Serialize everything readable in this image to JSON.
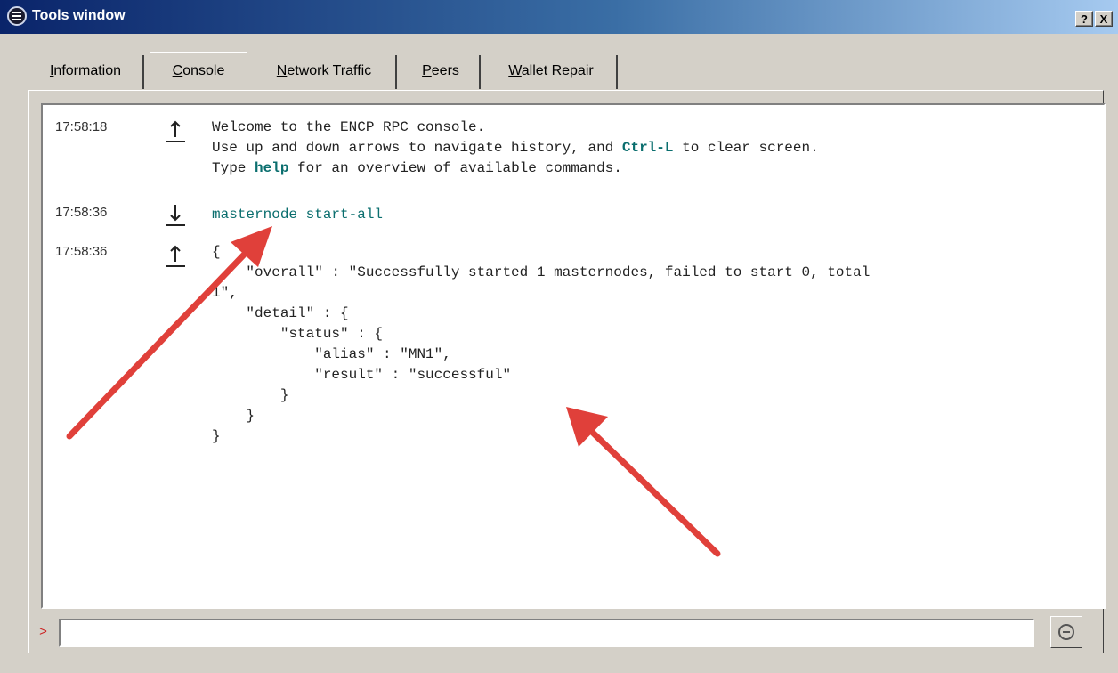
{
  "window": {
    "title": "Tools window",
    "help_button": "?",
    "close_button": "X"
  },
  "tabs": [
    {
      "label_pre": "",
      "label_mnemonic": "I",
      "label_post": "nformation"
    },
    {
      "label_pre": "",
      "label_mnemonic": "C",
      "label_post": "onsole"
    },
    {
      "label_pre": "",
      "label_mnemonic": "N",
      "label_post": "etwork Traffic"
    },
    {
      "label_pre": "",
      "label_mnemonic": "P",
      "label_post": "eers"
    },
    {
      "label_pre": "",
      "label_mnemonic": "W",
      "label_post": "allet Repair"
    }
  ],
  "active_tab": "Console",
  "console": {
    "messages": [
      {
        "time": "17:58:18",
        "direction": "reply",
        "line1": "Welcome to the ENCP RPC console.",
        "line2_pre": "Use up and down arrows to navigate history, and ",
        "line2_kw": "Ctrl-L",
        "line2_post": " to clear screen.",
        "line3_pre": "Type ",
        "line3_kw": "help",
        "line3_post": " for an overview of available commands."
      },
      {
        "time": "17:58:36",
        "direction": "request",
        "command": "masternode start-all"
      },
      {
        "time": "17:58:36",
        "direction": "reply",
        "json_lines": [
          "{",
          "    \"overall\" : \"Successfully started 1 masternodes, failed to start 0, total",
          "1\",",
          "    \"detail\" : {",
          "        \"status\" : {",
          "            \"alias\" : \"MN1\",",
          "            \"result\" : \"successful\"",
          "        }",
          "    }",
          "}"
        ]
      }
    ]
  },
  "input": {
    "prompt": ">",
    "value": "",
    "placeholder": ""
  },
  "colors": {
    "annotation_arrow": "#e0403a",
    "command_text": "#0a6e6e",
    "prompt": "#cc2222"
  },
  "icons": {
    "reply": "up-arrow-icon",
    "request": "down-arrow-icon",
    "clear": "clear-console-icon"
  }
}
